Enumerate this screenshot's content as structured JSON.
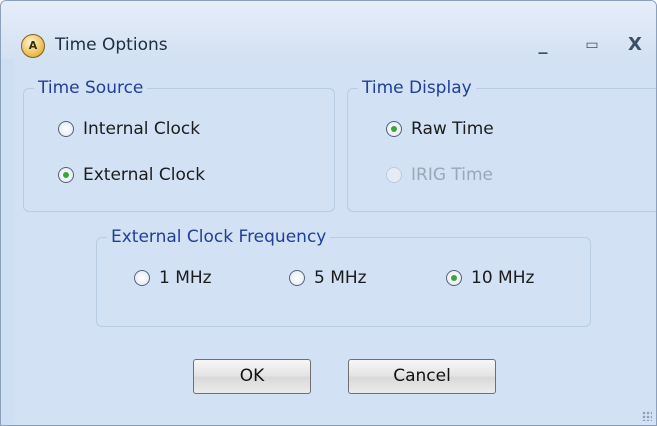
{
  "window": {
    "title": "Time Options",
    "app_icon_text": "A",
    "controls": {
      "minimize": "_",
      "maximize": "▭",
      "close": "X"
    }
  },
  "time_source": {
    "legend": "Time Source",
    "options": [
      {
        "label": "Internal Clock",
        "checked": false
      },
      {
        "label": "External Clock",
        "checked": true
      }
    ]
  },
  "time_display": {
    "legend": "Time Display",
    "options": [
      {
        "label": "Raw Time",
        "checked": true,
        "enabled": true
      },
      {
        "label": "IRIG Time",
        "checked": false,
        "enabled": false
      }
    ]
  },
  "clock_frequency": {
    "legend": "External Clock Frequency",
    "options": [
      {
        "label": "1 MHz",
        "checked": false
      },
      {
        "label": "5 MHz",
        "checked": false
      },
      {
        "label": "10 MHz",
        "checked": true
      }
    ]
  },
  "buttons": {
    "ok": "OK",
    "cancel": "Cancel"
  },
  "colors": {
    "accent_legend": "#1f3f98",
    "radio_checked": "#3da53b",
    "window_bg": "#d2e1f4"
  }
}
